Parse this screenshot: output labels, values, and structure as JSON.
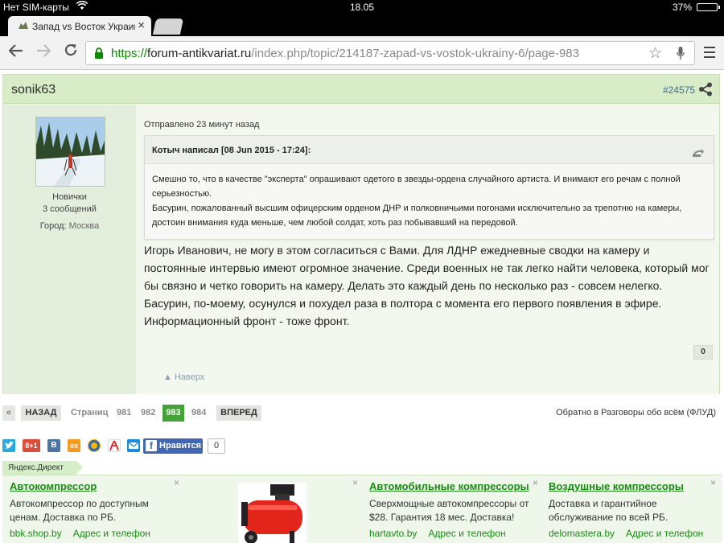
{
  "status_bar": {
    "carrier": "Нет SIM-карты",
    "time": "18.05",
    "battery": "37%",
    "battery_level": 0.37
  },
  "browser": {
    "tab_title": "Запад vs Восток Украины",
    "url_scheme": "https://",
    "url_host": "forum-antikvariat.ru",
    "url_path": "/index.php/topic/214187-zapad-vs-vostok-ukrainy-6/page-983"
  },
  "post": {
    "author": "sonik63",
    "post_id": "#24575",
    "rank": "Новички",
    "post_count": "3 сообщений",
    "city_label": "Город:",
    "city_value": "Москва",
    "posted": "Отправлено 23 минут назад",
    "quote_title": "Котыч написал [08 Jun 2015 - 17:24]:",
    "quote_line1": "Смешно то, что в качестве \"эксперта\" опрашивают одетого в звезды-ордена случайного артиста. И внимают его речам с полной серьезностью.",
    "quote_line2": "Басурин, пожалованный высшим офицерским орденом ДНР и полковничьими погонами исключительно  за трепотню на камеры, достоин внимания куда меньше, чем любой солдат, хоть раз побывавший на передовой.",
    "text": "Игорь Иванович, не могу в этом согласиться с Вами. Для ЛДНР ежедневные сводки на камеру и постоянные интервью имеют огромное значение. Среди военных не так легко найти человека, который мог бы связно и четко говорить на камеру. Делать это каждый день по несколько раз - совсем нелегко. Басурин, по-моему, осунулся и похудел раза в полтора с момента его первого появления в эфире. Информационный фронт - тоже фронт.",
    "reputation": "0",
    "back_to_top": "Наверх"
  },
  "pagination": {
    "prev_arrow": "«",
    "back": "НАЗАД",
    "pages_label": "Страниц",
    "pages": [
      "981",
      "982"
    ],
    "current": "983",
    "next_page": "984",
    "forward": "ВПЕРЕД",
    "back_link": "Обратно в Разговоры обо всём (ФЛУД)"
  },
  "social": {
    "gplus": "8+1",
    "vk": "В",
    "ok": "ок",
    "like_label": "Нравится",
    "f": "f",
    "like_count": "0",
    "colors": {
      "twitter": "#29a9e1",
      "gplus": "#dd4b39",
      "vk": "#4c75a3",
      "ok": "#f59a1d",
      "mail": "#168de2",
      "facebook": "#4267b2"
    }
  },
  "ads": {
    "label": "Яндекс.Директ",
    "close": "×",
    "items": [
      {
        "title": "Автокомпрессор",
        "text": "Автокомпрессор по доступным ценам. Доставка по РБ.",
        "domain": "bbk.shop.by",
        "addr": "Адрес и телефон"
      },
      {
        "title": "Автомобильные компрессоры",
        "text": "Сверхмощные автокомпрессоры от $28. Гарантия 18 мес. Доставка!",
        "domain": "hartavto.by",
        "addr": "Адрес и телефон"
      },
      {
        "title": "Воздушные компрессоры",
        "text": "Доставка и гарантийное обслуживание по всей РБ.",
        "domain": "delomastera.by",
        "addr": "Адрес и телефон"
      }
    ]
  },
  "accent_colors": {
    "green": "#43a336",
    "link_green": "#1a8b13",
    "header_green": "#d8ecc7"
  }
}
